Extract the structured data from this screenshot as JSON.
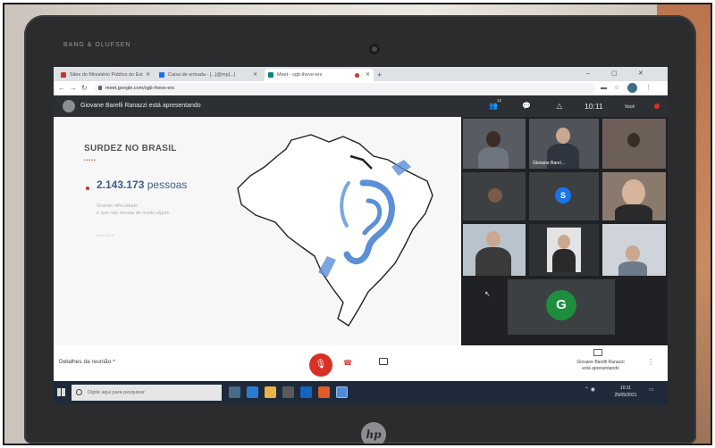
{
  "laptop": {
    "brand": "BANG & OLUFSEN",
    "logo": "hp"
  },
  "browser": {
    "tabs": [
      {
        "label": "Sites do Ministério Público do Est",
        "active": false,
        "icon": "favicon-red"
      },
      {
        "label": "Caixa de entrada - [...]@mp[...]",
        "active": false,
        "icon": "favicon-mail"
      },
      {
        "label": "Meet - sgb-iheve-ers",
        "active": true,
        "icon": "favicon-meet"
      }
    ],
    "new_tab": "+",
    "url": "meet.google.com/sgb-iheve-ers",
    "window_controls": [
      "–",
      "▢",
      "✕"
    ]
  },
  "meet": {
    "presenter_banner": "Giovane Barelli Ranazzi está apresentando",
    "participant_count": "12",
    "clock": "10:11",
    "you_label": "Você",
    "slide": {
      "title": "SURDEZ NO BRASIL",
      "dots": "•••••",
      "stat_number": "2.143.173",
      "stat_unit": "pessoas",
      "subtitle_line1": "Grande dificuldade",
      "subtitle_line2": "e que não escuta de modo algum",
      "footnote": "fonte IBGE"
    },
    "tiles": [
      {
        "name": ""
      },
      {
        "name": "Giovane Barel..."
      },
      {
        "name": ""
      },
      {
        "name": ""
      },
      {
        "name": ""
      },
      {
        "name": ""
      },
      {
        "name": ""
      },
      {
        "name": ""
      },
      {
        "name": ""
      },
      {
        "name": ""
      }
    ],
    "initials": {
      "s": "S",
      "g": "G"
    },
    "details_label": "Detalhes da reunião",
    "details_chevron": "^",
    "presenting_label_line1": "Giovane Barelli Ranazzi",
    "presenting_label_line2": "está apresentando",
    "more_icon": "⋮"
  },
  "taskbar": {
    "search_placeholder": "Digite aqui para pesquisar",
    "time": "10:11",
    "date": "25/05/2021"
  },
  "colors": {
    "meet_dark": "#2c2f33",
    "end_call_red": "#d93025",
    "accessibility_blue": "#5b8fd6",
    "initial_s": "#1a73e8",
    "initial_g": "#1e8e3e"
  }
}
